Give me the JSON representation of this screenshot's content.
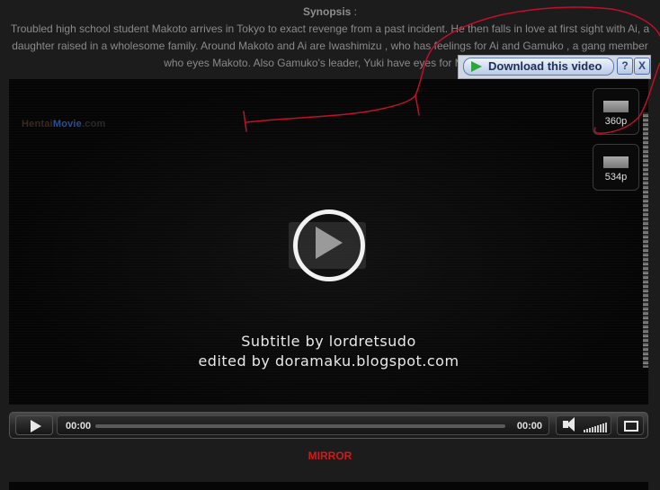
{
  "synopsis": {
    "heading": "Synopsis",
    "colon": " :",
    "text": "Troubled high school student Makoto arrives in Tokyo to exact revenge from a past incident. He then falls in love at first sight with Ai, a daughter raised in a wholesome family. Around Makoto and Ai are Iwashimizu , who has feelings for Ai and Gamuko , a gang member who eyes Makoto. Also Gamuko's leader, Yuki have eyes for Makoto t"
  },
  "player": {
    "watermark": {
      "part1": "Hentai",
      "part2": "Movie",
      "part3": ".com"
    },
    "subtitle_line1": "Subtitle by lordretsudo",
    "subtitle_line2": "edited by doramaku.blogspot.com",
    "quality_options": [
      {
        "label": "360p"
      },
      {
        "label": "534p"
      }
    ],
    "controls": {
      "current_time": "00:00",
      "duration": "00:00",
      "progress_fraction": 0.0
    },
    "icons": [
      "play-icon",
      "speaker-icon",
      "volume-bars-icon",
      "fullscreen-icon"
    ]
  },
  "download_bar": {
    "label": "Download this video",
    "help": "?",
    "close": "X",
    "accent": "#2fa540"
  },
  "mirror": {
    "label": "MIRROR",
    "color": "#d11a1a"
  },
  "scribble": {
    "color": "#c0102a"
  }
}
